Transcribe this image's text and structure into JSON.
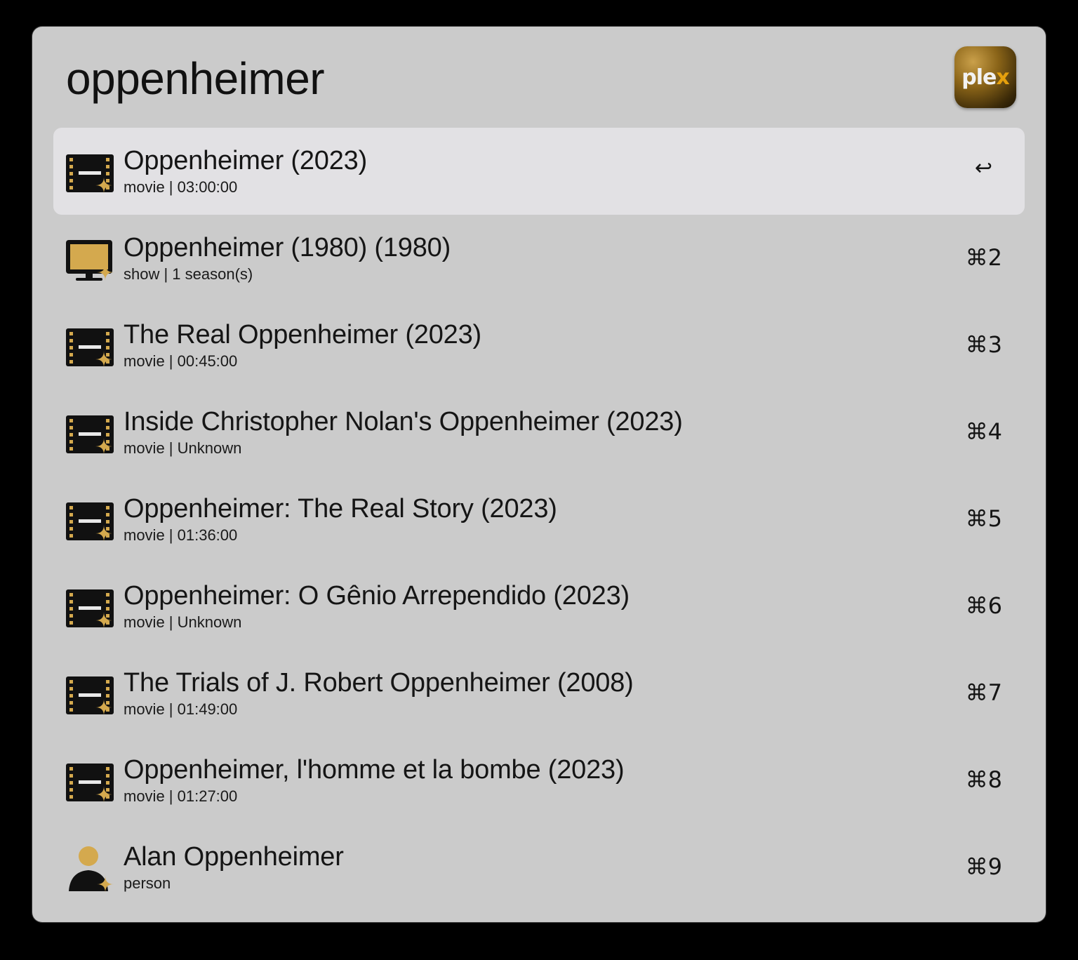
{
  "search": {
    "query": "oppenheimer",
    "placeholder": ""
  },
  "app_icon": {
    "name": "plex-icon",
    "label_main": "ple",
    "label_accent": "x"
  },
  "colors": {
    "window_bg": "#cbcbcb",
    "selected_row_bg": "#e2e1e4",
    "accent_gold": "#d4a94e",
    "icon_dark": "#111111"
  },
  "results": [
    {
      "icon": "film-icon",
      "title": "Oppenheimer (2023)",
      "subtitle": "movie | 03:00:00",
      "shortcut": "↩",
      "selected": true
    },
    {
      "icon": "tv-icon",
      "title": "Oppenheimer (1980) (1980)",
      "subtitle": "show | 1 season(s)",
      "shortcut": "⌘2",
      "selected": false
    },
    {
      "icon": "film-icon",
      "title": "The Real Oppenheimer (2023)",
      "subtitle": "movie | 00:45:00",
      "shortcut": "⌘3",
      "selected": false
    },
    {
      "icon": "film-icon",
      "title": "Inside Christopher Nolan's Oppenheimer (2023)",
      "subtitle": "movie | Unknown",
      "shortcut": "⌘4",
      "selected": false
    },
    {
      "icon": "film-icon",
      "title": "Oppenheimer: The Real Story (2023)",
      "subtitle": "movie | 01:36:00",
      "shortcut": "⌘5",
      "selected": false
    },
    {
      "icon": "film-icon",
      "title": "Oppenheimer: O Gênio Arrependido (2023)",
      "subtitle": "movie | Unknown",
      "shortcut": "⌘6",
      "selected": false
    },
    {
      "icon": "film-icon",
      "title": "The Trials of J. Robert Oppenheimer (2008)",
      "subtitle": "movie | 01:49:00",
      "shortcut": "⌘7",
      "selected": false
    },
    {
      "icon": "film-icon",
      "title": "Oppenheimer, l'homme et la bombe (2023)",
      "subtitle": "movie | 01:27:00",
      "shortcut": "⌘8",
      "selected": false
    },
    {
      "icon": "person-icon",
      "title": "Alan Oppenheimer",
      "subtitle": "person",
      "shortcut": "⌘9",
      "selected": false
    }
  ]
}
